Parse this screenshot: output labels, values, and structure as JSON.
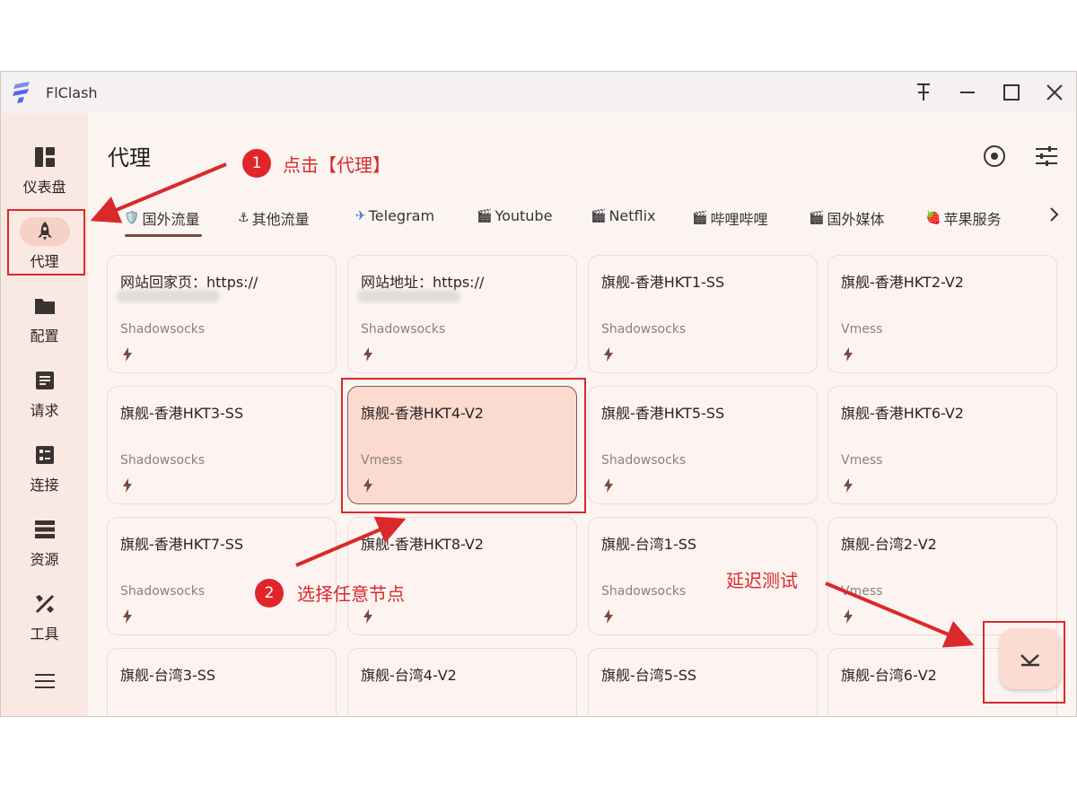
{
  "window": {
    "title": "FlClash"
  },
  "sidebar": {
    "items": [
      {
        "label": "仪表盘",
        "icon": "dashboard-icon"
      },
      {
        "label": "代理",
        "icon": "rocket-icon"
      },
      {
        "label": "配置",
        "icon": "folder-icon"
      },
      {
        "label": "请求",
        "icon": "request-icon"
      },
      {
        "label": "连接",
        "icon": "connections-icon"
      },
      {
        "label": "资源",
        "icon": "resources-icon"
      },
      {
        "label": "工具",
        "icon": "tools-icon"
      }
    ]
  },
  "header": {
    "title": "代理"
  },
  "tabs": [
    {
      "label": "国外流量",
      "emoji": "🛡️"
    },
    {
      "label": "其他流量",
      "emoji": "⚓"
    },
    {
      "label": "Telegram",
      "emoji": "✈"
    },
    {
      "label": "Youtube",
      "emoji": "🎬"
    },
    {
      "label": "Netflix",
      "emoji": "🎬"
    },
    {
      "label": "哔哩哔哩",
      "emoji": "🎬"
    },
    {
      "label": "国外媒体",
      "emoji": "🎬"
    },
    {
      "label": "苹果服务",
      "emoji": "🍓"
    }
  ],
  "nodes": [
    {
      "name": "网站回家页：https://",
      "type": "Shadowsocks"
    },
    {
      "name": "网站地址：https://",
      "type": "Shadowsocks"
    },
    {
      "name": "旗舰-香港HKT1-SS",
      "type": "Shadowsocks"
    },
    {
      "name": "旗舰-香港HKT2-V2",
      "type": "Vmess"
    },
    {
      "name": "旗舰-香港HKT3-SS",
      "type": "Shadowsocks"
    },
    {
      "name": "旗舰-香港HKT4-V2",
      "type": "Vmess"
    },
    {
      "name": "旗舰-香港HKT5-SS",
      "type": "Shadowsocks"
    },
    {
      "name": "旗舰-香港HKT6-V2",
      "type": "Vmess"
    },
    {
      "name": "旗舰-香港HKT7-SS",
      "type": "Shadowsocks"
    },
    {
      "name": "旗舰-香港HKT8-V2",
      "type": ""
    },
    {
      "name": "旗舰-台湾1-SS",
      "type": "Shadowsocks"
    },
    {
      "name": "旗舰-台湾2-V2",
      "type": "Vmess"
    },
    {
      "name": "旗舰-台湾3-SS",
      "type": ""
    },
    {
      "name": "旗舰-台湾4-V2",
      "type": ""
    },
    {
      "name": "旗舰-台湾5-SS",
      "type": ""
    },
    {
      "name": "旗舰-台湾6-V2",
      "type": ""
    }
  ],
  "annotations": {
    "step1_number": "1",
    "step1_text": "点击【代理】",
    "step2_number": "2",
    "step2_text": "选择任意节点",
    "step3_text": "延迟测试"
  },
  "colors": {
    "accent": "#d9292b",
    "selected_card": "#fbdacf",
    "sidebar_bg": "#fae9e3",
    "fab_bg": "#fbdcd1"
  }
}
